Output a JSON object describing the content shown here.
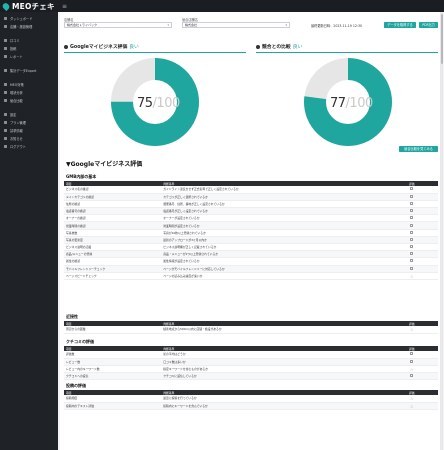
{
  "app": {
    "name": "MEOチェキ"
  },
  "sidebar": {
    "group1": [
      {
        "label": "ダッシュボード",
        "icon": "dashboard-icon"
      },
      {
        "label": "店舗・施設管理",
        "icon": "store-icon"
      }
    ],
    "group2": [
      {
        "label": "口コミ",
        "icon": "review-icon"
      },
      {
        "label": "投稿",
        "icon": "post-icon"
      },
      {
        "label": "レポート",
        "icon": "report-icon"
      }
    ],
    "group3": [
      {
        "label": "集計データExport",
        "icon": "export-icon"
      }
    ],
    "group4": [
      {
        "label": "MEO対策",
        "icon": "meo-icon"
      },
      {
        "label": "現状分析",
        "icon": "analysis-icon"
      },
      {
        "label": "競合比較",
        "icon": "compare-icon"
      }
    ],
    "group5": [
      {
        "label": "設定",
        "icon": "settings-icon"
      },
      {
        "label": "プラン管理",
        "icon": "plan-icon"
      },
      {
        "label": "請求情報",
        "icon": "billing-icon"
      },
      {
        "label": "お知らせ",
        "icon": "news-icon"
      },
      {
        "label": "ログアウト",
        "icon": "logout-icon"
      }
    ]
  },
  "filters": {
    "store_label": "店舗名",
    "store_value": "株式会社トライバック",
    "competitor_label": "競合店舗名",
    "competitor_value": "株式会社",
    "period": "最終更新日時：2023-11-19 12:30",
    "btn_fetch": "データを取得する",
    "btn_pdf": "PDF出力"
  },
  "cards": {
    "left": {
      "title": "Googleマイビジネス評価",
      "status": "良い",
      "score": "75",
      "den": "/100",
      "value": 75
    },
    "right": {
      "title": "競合との比較",
      "status": "良い",
      "score": "77",
      "den": "/100",
      "value": 77
    },
    "compare_button": "競合比較を見てみる"
  },
  "section": {
    "title": "▼Googleマイビジネス評価",
    "col_item": "項目",
    "col_criteria": "判断基準",
    "col_eval": "評価"
  },
  "tables": {
    "basic": {
      "title": "GMB内部の基本",
      "rows": [
        {
          "item": "ビジネス名の確認",
          "criteria": "ガイドライン違反をせず正式名称で正しく設定されているか",
          "eval": "check"
        },
        {
          "item": "メインカテゴリの確認",
          "criteria": "カテゴリが正しく選択されているか",
          "eval": "check"
        },
        {
          "item": "住所の確認",
          "criteria": "郵便番号、住所、番地が正しく設定されているか",
          "eval": "check"
        },
        {
          "item": "電話番号の確認",
          "criteria": "電話番号が正しく設定されているか",
          "eval": "check"
        },
        {
          "item": "オーナーの確認",
          "criteria": "オーナーが設定されているか",
          "eval": "check"
        },
        {
          "item": "営業時間の確認",
          "criteria": "営業時間が設定されているか",
          "eval": "check"
        },
        {
          "item": "写真枚数",
          "criteria": "写真が10枚以上登録されているか",
          "eval": "check"
        },
        {
          "item": "写真の更新度",
          "criteria": "最新のアップロードが3ヶ月以内か",
          "eval": "check"
        },
        {
          "item": "ビジネス説明の記載",
          "criteria": "ビジネス説明欄が正しく記載されているか",
          "eval": "check"
        },
        {
          "item": "商品/メニューの登録",
          "criteria": "商品・メニューが1つ以上登録されているか",
          "eval": "check"
        },
        {
          "item": "属性の確認",
          "criteria": "属性情報が設定されているか",
          "eval": "check"
        },
        {
          "item": "モバイルフレンドリーチェック",
          "criteria": "ページがモバイルフレンドリーに対応しているか",
          "eval": "check"
        },
        {
          "item": "ページスピードチェック",
          "criteria": "ページの読み込み速度が速いか",
          "eval": "warn"
        }
      ]
    },
    "proximity": {
      "title": "近接性",
      "rows": [
        {
          "item": "周辺からの距離",
          "criteria": "検索地点から500m以内に店舗・施設があるか",
          "eval": "warn"
        }
      ]
    },
    "reviews": {
      "title": "クチコミの評価",
      "rows": [
        {
          "item": "評価数",
          "criteria": "星の平均はどうか",
          "eval": "check"
        },
        {
          "item": "レビュー数",
          "criteria": "口コミ数は多いか",
          "eval": "check"
        },
        {
          "item": "レビュー内のキーワード数",
          "criteria": "指定キーワードを含むものがあるか",
          "eval": "warn"
        },
        {
          "item": "クチコミへの返信",
          "criteria": "クチコミに返信しているか",
          "eval": "check"
        }
      ]
    },
    "posts": {
      "title": "投稿の評価",
      "rows": [
        {
          "item": "投稿頻度",
          "criteria": "最近に投稿を行っているか",
          "eval": "warn"
        },
        {
          "item": "投稿内のテキスト評価",
          "criteria": "投稿内にキーワードを含んでいるか",
          "eval": "warn"
        }
      ]
    }
  },
  "colors": {
    "accent": "#1fa69e",
    "donut_rest": "#e6e6e6",
    "sidebar": "#1f2226"
  }
}
